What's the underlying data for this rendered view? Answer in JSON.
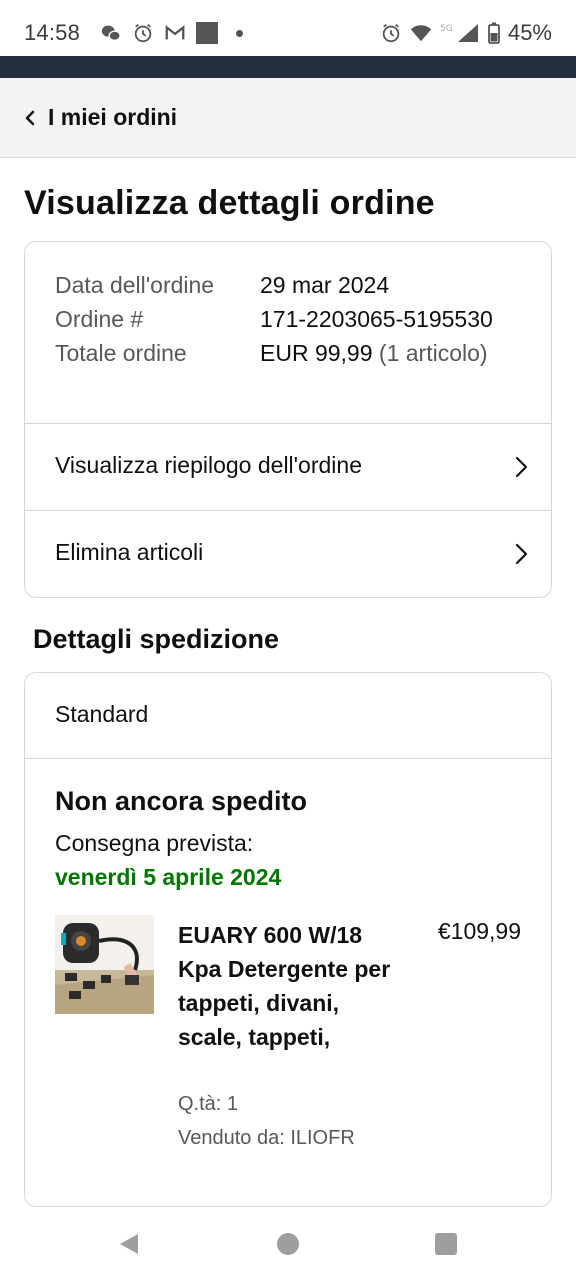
{
  "status_bar": {
    "time": "14:58",
    "battery": "45%",
    "network": "5G",
    "left_icons": [
      "wechat-icon",
      "alarm-icon",
      "gmail-icon",
      "app-square-icon",
      "dot-icon"
    ],
    "right_icons": [
      "alarm-icon",
      "wifi-icon",
      "signal-icon",
      "battery-icon"
    ]
  },
  "header": {
    "back_label": "I miei ordini"
  },
  "page": {
    "title": "Visualizza dettagli ordine"
  },
  "order_summary": {
    "date_label": "Data dell'ordine",
    "date_value": "29 mar 2024",
    "number_label": "Ordine #",
    "number_value": "171-2203065-5195530",
    "total_label": "Totale ordine",
    "total_value": "EUR 99,99",
    "total_items": "(1 articolo)",
    "link_summary": "Visualizza riepilogo dell'ordine",
    "link_remove": "Elimina articoli"
  },
  "shipping": {
    "section_title": "Dettagli spedizione",
    "method": "Standard",
    "status": "Non ancora spedito",
    "delivery_label": "Consegna prevista:",
    "delivery_date": "venerdì 5 aprile 2024",
    "delivery_date_color": "#007600",
    "item": {
      "title": "EUARY 600 W/18 Kpa Detergente per tappeti, divani, scale, tappeti,",
      "price": "€109,99",
      "qty": "Q.tà: 1",
      "seller": "Venduto da: ILIOFR"
    }
  },
  "colors": {
    "dark_bar": "#232f3e",
    "accent_green": "#007600",
    "muted_text": "#565959",
    "border": "#d5d9d9"
  },
  "nav": {
    "icons": [
      "nav-back-icon",
      "nav-home-icon",
      "nav-recents-icon"
    ]
  }
}
